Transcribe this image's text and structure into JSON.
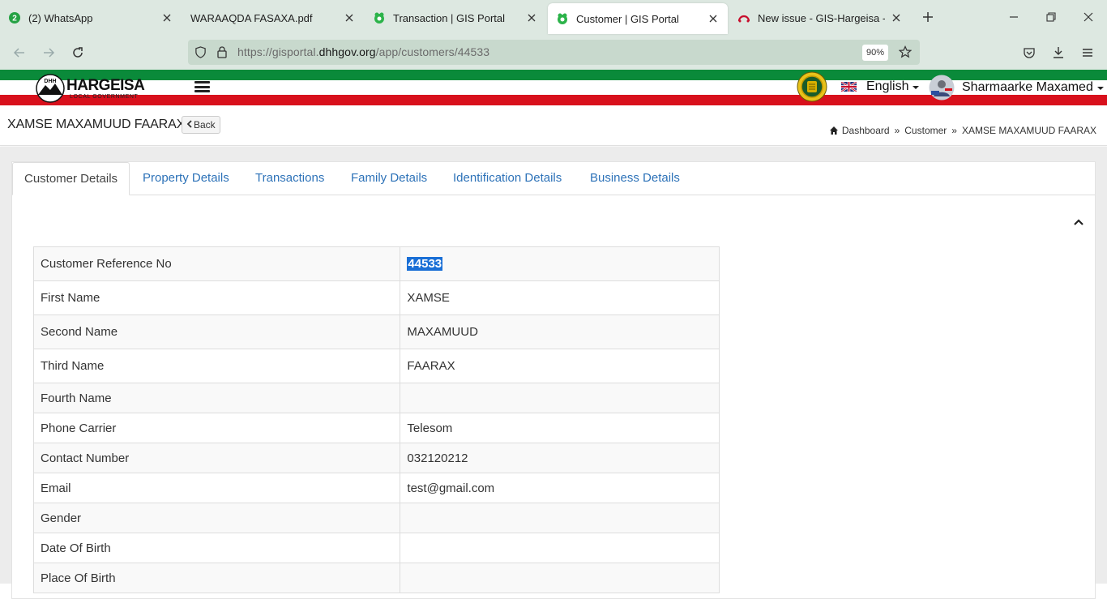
{
  "browser": {
    "tabs": [
      {
        "title": "(2) WhatsApp",
        "badge": "2",
        "active": false
      },
      {
        "title": "WARAAQDA FASAXA.pdf",
        "active": false
      },
      {
        "title": "Transaction | GIS Portal",
        "active": false
      },
      {
        "title": "Customer | GIS Portal",
        "active": true
      },
      {
        "title": "New issue - GIS-Hargeisa - Tean",
        "active": false
      }
    ],
    "url_prefix": "https://gisportal.",
    "url_host": "dhhgov.org",
    "url_path": "/app/customers/44533",
    "zoom": "90%"
  },
  "header": {
    "logo_title": "HARGEISA",
    "logo_subtitle": "LOCAL GOVERNMENT",
    "logo_badge": "DHH",
    "language": "English",
    "user_name": "Sharmaarke Maxamed"
  },
  "page": {
    "title": "XAMSE MAXAMUUD FAARAX",
    "back_label": "Back",
    "breadcrumb": [
      "Dashboard",
      "Customer",
      "XAMSE MAXAMUUD FAARAX"
    ],
    "breadcrumb_sep": "»"
  },
  "tabs": [
    "Customer Details",
    "Property Details",
    "Transactions",
    "Family Details",
    "Identification Details",
    "Business Details"
  ],
  "details": {
    "rows": [
      {
        "label": "Customer Reference No",
        "value": "44533"
      },
      {
        "label": "First Name",
        "value": "XAMSE"
      },
      {
        "label": "Second Name",
        "value": "MAXAMUUD"
      },
      {
        "label": "Third Name",
        "value": "FAARAX"
      },
      {
        "label": "Fourth Name",
        "value": ""
      },
      {
        "label": "Phone Carrier",
        "value": "Telesom"
      },
      {
        "label": "Contact Number",
        "value": "032120212"
      },
      {
        "label": "Email",
        "value": "test@gmail.com"
      },
      {
        "label": "Gender",
        "value": ""
      },
      {
        "label": "Date Of Birth",
        "value": ""
      },
      {
        "label": "Place Of Birth",
        "value": ""
      }
    ]
  },
  "colors": {
    "flag_green": "#0a8a3a",
    "flag_red": "#d8101c",
    "link_blue": "#2d72b8",
    "selection_blue": "#1a6fd6",
    "browser_chrome": "#dde8e1"
  }
}
